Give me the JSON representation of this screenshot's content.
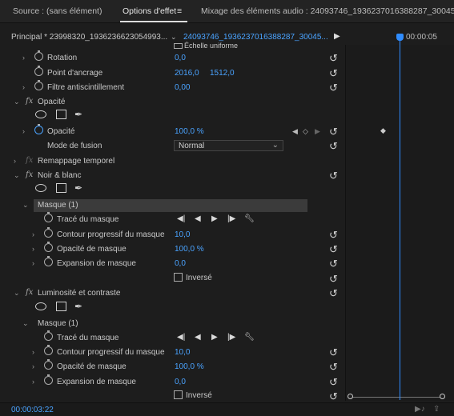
{
  "tabs": {
    "source": "Source : (sans élément)",
    "effect_options": "Options d'effet",
    "menu_glyph": "≡",
    "audio_mixer": "Mixage des éléments audio : 24093746_1936237016388287_30045"
  },
  "header": {
    "sequence": "Principal * 23998320_1936236623054993...",
    "clip": "24093746_1936237016388287_30045...",
    "timecode_label": "00:00:05"
  },
  "rows": {
    "echelle": "Échelle uniforme",
    "rotation": {
      "label": "Rotation",
      "value": "0,0"
    },
    "anchor": {
      "label": "Point d'ancrage",
      "x": "2016,0",
      "y": "1512,0"
    },
    "flicker": {
      "label": "Filtre antiscintillement",
      "value": "0,00"
    },
    "opacity_group": "Opacité",
    "opacity": {
      "label": "Opacité",
      "value": "100,0 %"
    },
    "blend": {
      "label": "Mode de fusion",
      "value": "Normal"
    },
    "time_remap": "Remappage temporel",
    "bw": "Noir & blanc",
    "mask1": "Masque (1)",
    "mask_path": "Tracé du masque",
    "feather": {
      "label": "Contour progressif du masque",
      "value": "10,0"
    },
    "mask_opacity": {
      "label": "Opacité de masque",
      "value": "100,0 %"
    },
    "mask_expansion": {
      "label": "Expansion de masque",
      "value": "0,0"
    },
    "inverted": "Inversé",
    "brightness": "Luminosité et contraste",
    "mask2": "Masque (1)",
    "mask_path2": "Tracé du masque",
    "feather2": {
      "label": "Contour progressif du masque",
      "value": "10,0"
    },
    "mask_opacity2": {
      "label": "Opacité de masque",
      "value": "100,0 %"
    },
    "mask_expansion2": {
      "label": "Expansion de masque",
      "value": "0,0"
    },
    "inverted2": "Inversé"
  },
  "footer": {
    "timecode": "00:00:03:22"
  },
  "colors": {
    "accent": "#4aa3ff",
    "background": "#1d1d1d"
  }
}
